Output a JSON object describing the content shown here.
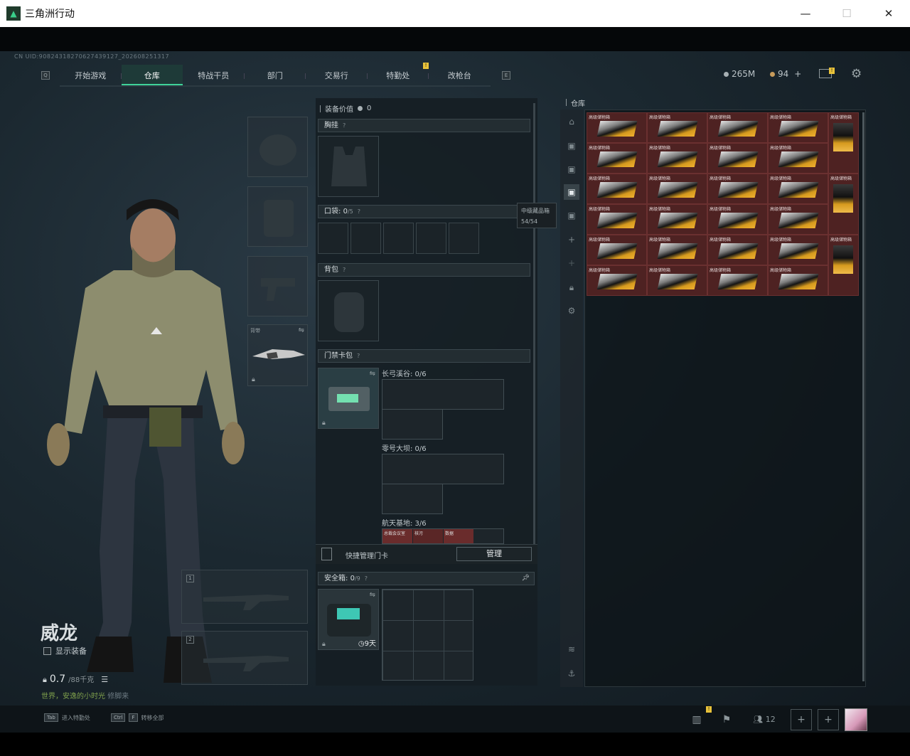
{
  "window": {
    "title": "三角洲行动",
    "logo_icon": "delta-logo-icon",
    "minimize": "—",
    "maximize": "☐",
    "close": "✕"
  },
  "uid": "CN UID:9082431827062743912​7_202608251317",
  "nav": {
    "left_key": "Q",
    "right_key": "E",
    "tabs": [
      "开始游戏",
      "仓库",
      "特战干员",
      "部门",
      "交易行",
      "特勤处",
      "改枪台"
    ],
    "active": "仓库",
    "badge": "!"
  },
  "currency": {
    "silver": "265M",
    "gold": "94",
    "gold_add": "+",
    "mail_badge": "!"
  },
  "character": {
    "name": "威龙",
    "show_equipment": "显示装备",
    "weight": "0.7",
    "weight_max": "/88千克",
    "subtitle_green": "世界，安逸的小时光",
    "subtitle_gray": "修脚来",
    "melee_label": "背带",
    "weapon_slot_1": "1",
    "weapon_slot_2": "2"
  },
  "middle": {
    "equip_value_label": "装备价值",
    "equip_value": "0",
    "chest_label": "胸挂",
    "pocket_label": "口袋:",
    "pocket_count": "0",
    "pocket_cap": "/5",
    "backpack_label": "背包",
    "keycard_label": "门禁卡包",
    "keycard_groups": [
      {
        "name": "长弓溪谷: 0/6"
      },
      {
        "name": "零号大坝: 0/6"
      },
      {
        "name": "航天基地: 3/6"
      }
    ],
    "keycard_item_labels": [
      "总裁会议室",
      "核污",
      "数据"
    ],
    "quick_manage": "快捷管理门卡",
    "manage_btn": "管理",
    "safebox_label": "安全箱:",
    "safebox_count": "0",
    "safebox_cap": "/9",
    "safebox_days": "9天",
    "help": "?"
  },
  "stash": {
    "title": "仓库",
    "item_name": "高级储物箱",
    "rows": 6,
    "tooltip_title": "中级藏品箱",
    "tooltip_count": "54/54"
  },
  "bottom": {
    "tab_key": "Tab",
    "tab_text": "进入特勤处",
    "ctrl_key": "Ctrl",
    "f_key": "F",
    "ctrl_text": "转移全部",
    "friends": "12",
    "badge": "!"
  }
}
